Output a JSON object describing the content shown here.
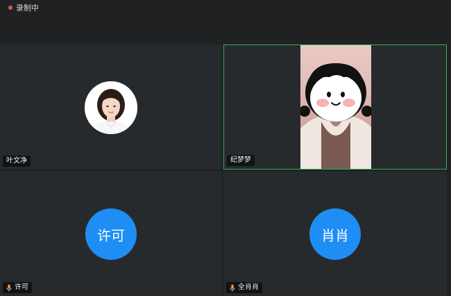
{
  "recording": {
    "label": "录制中",
    "dot_color": "#e05a4a"
  },
  "participants": [
    {
      "name": "叶文净",
      "display": "photo",
      "mic_icon": false
    },
    {
      "name": "纪梦梦",
      "display": "video",
      "active_speaker": true,
      "mic_icon": false
    },
    {
      "name": "许可",
      "display": "initials",
      "initials": "许可",
      "mic_icon": true
    },
    {
      "name": "全肖肖",
      "display": "initials",
      "initials": "肖肖",
      "mic_icon": true
    }
  ],
  "colors": {
    "active_border": "#2fb35a",
    "avatar_bg": "#1e8ef5"
  }
}
